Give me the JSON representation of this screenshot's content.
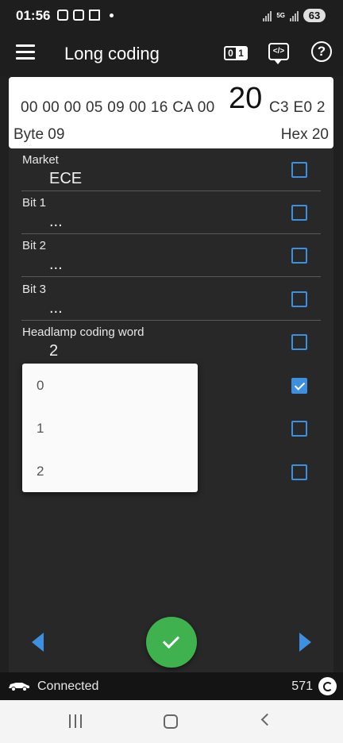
{
  "status_bar": {
    "time": "01:56",
    "network": "5G",
    "battery": "63"
  },
  "app_bar": {
    "title": "Long coding",
    "toggle_icon": "binary-toggle-icon",
    "toggle_left": "0",
    "toggle_right": "1",
    "code_icon": "code-view-icon",
    "code_label": "</>",
    "help_icon": "help-icon",
    "help_label": "?"
  },
  "hex_panel": {
    "before": "00 00 00 05 09 00 16 CA 00",
    "selected": "20",
    "after": "C3 E0 2",
    "byte_label": "Byte 09",
    "hex_label": "Hex 20"
  },
  "rows": [
    {
      "title": "Market",
      "value": "ECE",
      "checked": false
    },
    {
      "title": "Bit 1",
      "value": "...",
      "checked": false
    },
    {
      "title": "Bit 2",
      "value": "...",
      "checked": false
    },
    {
      "title": "Bit 3",
      "value": "...",
      "checked": false
    },
    {
      "title": "Headlamp coding word",
      "value": "2",
      "checked": false
    }
  ],
  "extra_checkboxes": [
    {
      "checked": true
    },
    {
      "checked": false
    },
    {
      "checked": false
    }
  ],
  "dropdown": {
    "options": [
      "0",
      "1",
      "2"
    ]
  },
  "connection": {
    "status": "Connected",
    "count": "571"
  },
  "colors": {
    "accent": "#3d8fe0",
    "confirm": "#3fb24f",
    "background": "#202020"
  }
}
